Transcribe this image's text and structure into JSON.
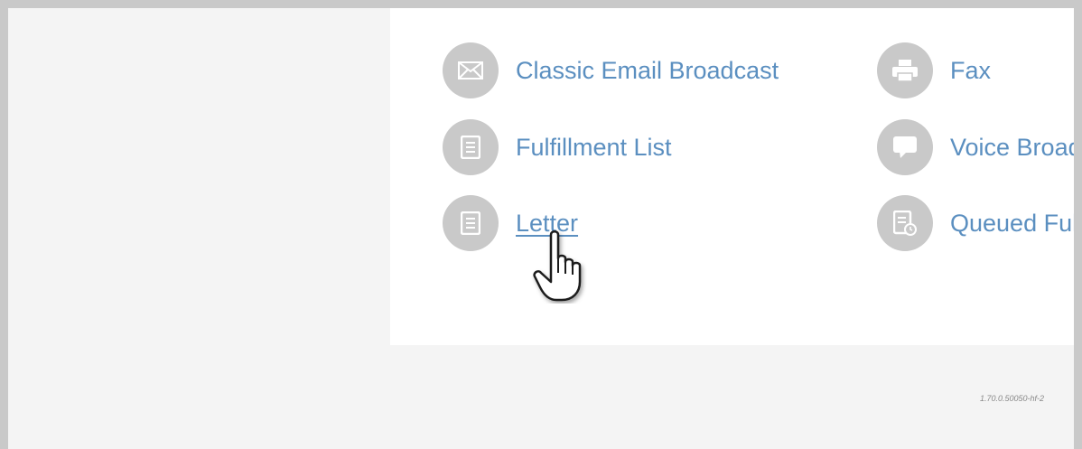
{
  "menu": {
    "left": [
      {
        "label": "Classic Email Broadcast",
        "icon": "envelope-icon"
      },
      {
        "label": "Fulfillment List",
        "icon": "document-icon"
      },
      {
        "label": "Letter",
        "icon": "document-icon"
      }
    ],
    "right": [
      {
        "label": "Fax",
        "icon": "printer-icon"
      },
      {
        "label": "Voice Broadcast",
        "icon": "speech-bubble-icon"
      },
      {
        "label": "Queued Fulfillment",
        "icon": "document-clock-icon"
      }
    ]
  },
  "footer": {
    "version": "1.70.0.50050-hf-2"
  },
  "colors": {
    "link": "#5b8fc0",
    "icon_bg": "#c9c9c9",
    "page_bg": "#f4f4f4",
    "card_bg": "#ffffff"
  }
}
